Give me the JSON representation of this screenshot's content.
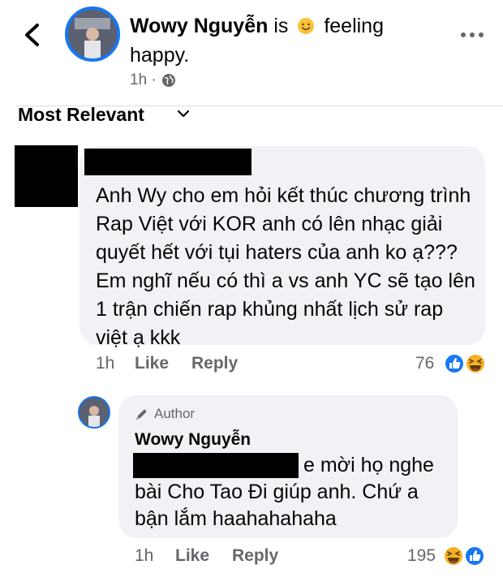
{
  "header": {
    "back_icon": "chevron-left-icon",
    "author_name": "Wowy Nguyễn",
    "is_text": "is",
    "feeling_text": "feeling",
    "feeling_line2": "happy.",
    "time": "1h ·",
    "audience_icon": "globe-icon",
    "more_icon": "more-horizontal-icon"
  },
  "sort": {
    "label": "Most Relevant",
    "icon": "chevron-down-icon"
  },
  "comment": {
    "name_redacted": true,
    "text": "Anh Wy cho em hỏi kết thúc chương trình Rap Việt với KOR anh có lên nhạc giải quyết hết với tụi haters của anh ko ạ??? Em nghĩ nếu có thì a vs anh YC sẽ tạo lên 1 trận chiến rap khủng nhất lịch sử rap việt ạ kkk",
    "time": "1h",
    "like_label": "Like",
    "reply_label": "Reply",
    "reaction_count": "76",
    "reactions": [
      "like-reaction-icon",
      "haha-reaction-icon"
    ]
  },
  "reply": {
    "badge_label": "Author",
    "badge_icon": "pencil-icon",
    "name": "Wowy Nguyễn",
    "line1": "e mời họ nghe",
    "line2": "bài Cho Tao Đi giúp anh. Chứ a",
    "line3": "bận lắm haahahahaha",
    "time": "1h",
    "like_label": "Like",
    "reply_label": "Reply",
    "reaction_count": "195",
    "reactions": [
      "haha-reaction-icon",
      "like-reaction-icon"
    ]
  },
  "colors": {
    "accent": "#1877f2",
    "secondary_text": "#65676b",
    "bubble": "#f0f2f5",
    "haha": "#f7b125"
  }
}
